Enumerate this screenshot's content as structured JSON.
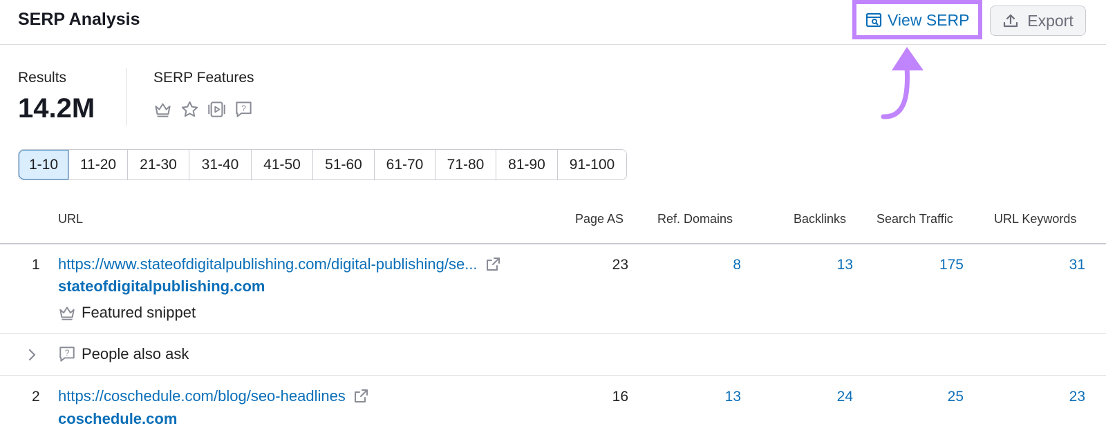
{
  "header": {
    "title": "SERP Analysis",
    "view_serp_label": "View SERP",
    "export_label": "Export"
  },
  "summary": {
    "results_label": "Results",
    "results_value": "14.2M",
    "features_label": "SERP Features",
    "feature_icons": [
      "crown-icon",
      "star-icon",
      "video-icon",
      "question-bubble-icon"
    ]
  },
  "pagination": {
    "pages": [
      "1-10",
      "11-20",
      "21-30",
      "31-40",
      "41-50",
      "51-60",
      "61-70",
      "71-80",
      "81-90",
      "91-100"
    ],
    "active": "1-10"
  },
  "table": {
    "columns": {
      "url": "URL",
      "page_as": "Page AS",
      "ref_domains": "Ref. Domains",
      "backlinks": "Backlinks",
      "search_traffic": "Search Traffic",
      "url_keywords": "URL Keywords"
    },
    "rows": [
      {
        "rank": "1",
        "url": "https://www.stateofdigitalpublishing.com/digital-publishing/se...",
        "domain": "stateofdigitalpublishing.com",
        "feature": "Featured snippet",
        "page_as": "23",
        "ref_domains": "8",
        "backlinks": "13",
        "search_traffic": "175",
        "url_keywords": "31"
      },
      {
        "paa_label": "People also ask"
      },
      {
        "rank": "2",
        "url": "https://coschedule.com/blog/seo-headlines",
        "domain": "coschedule.com",
        "page_as": "16",
        "ref_domains": "13",
        "backlinks": "24",
        "search_traffic": "25",
        "url_keywords": "23"
      }
    ]
  },
  "colors": {
    "link": "#0b6fb8",
    "highlight": "#c084fc",
    "active_page_bg": "#dbeefe"
  }
}
